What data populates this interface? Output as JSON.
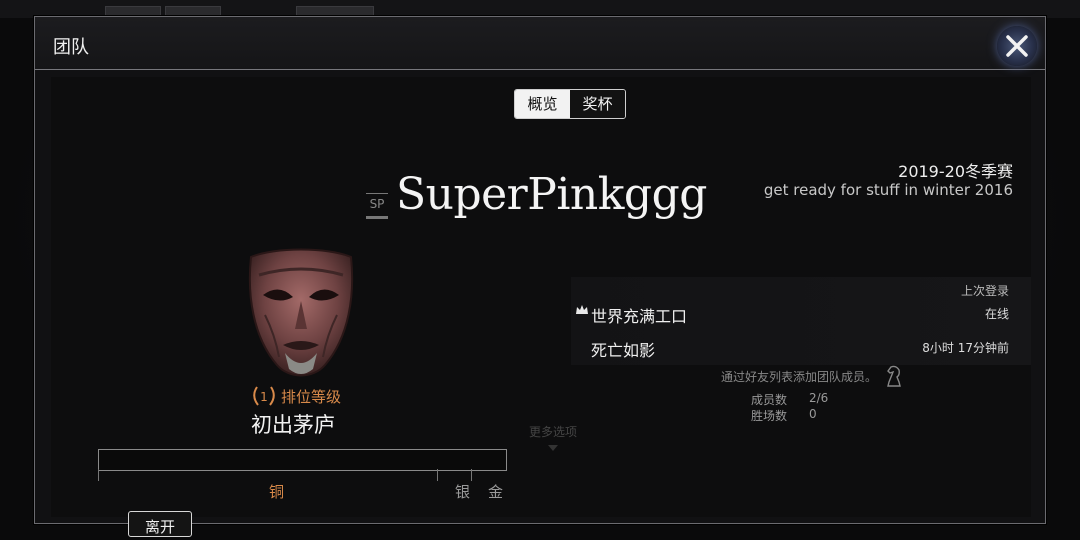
{
  "window": {
    "title": "团队"
  },
  "tabs": [
    {
      "label": "概览",
      "active": true
    },
    {
      "label": "奖杯",
      "active": false
    }
  ],
  "team": {
    "badge": "SP",
    "name": "SuperPinkggg",
    "season": "2019-20冬季赛",
    "motto": "get ready for stuff in winter 2016"
  },
  "rank": {
    "number": "1",
    "label": "排位等级",
    "name": "初出茅庐",
    "progress": 0.0,
    "tiers": [
      "铜",
      "银",
      "金"
    ]
  },
  "members": {
    "last_login_header": "上次登录",
    "list": [
      {
        "name": "世界充满工口",
        "status": "在线",
        "leader": true
      },
      {
        "name": "死亡如影",
        "status": "8小时 17分钟前",
        "leader": false
      }
    ]
  },
  "hint": "通过好友列表添加团队成员。",
  "stats": {
    "members_label": "成员数",
    "members_value": "2/6",
    "wins_label": "胜场数",
    "wins_value": "0"
  },
  "more_options": "更多选项",
  "buttons": {
    "leave": "离开"
  },
  "colors": {
    "accent_rank": "#d98a4a",
    "panel_border": "#6b6b70"
  },
  "icons": [
    "close-icon",
    "crown-icon",
    "laurel-icon",
    "knight-icon",
    "chevron-down-icon"
  ]
}
